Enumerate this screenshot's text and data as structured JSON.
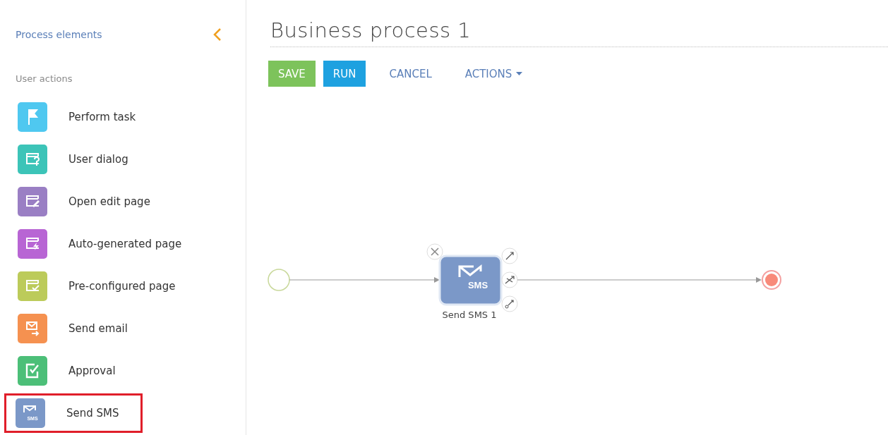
{
  "sidebar": {
    "title": "Process elements",
    "section": "User actions",
    "items": [
      {
        "label": "Perform task",
        "kind": "flag",
        "color": "#4fc8f0",
        "highlighted": false
      },
      {
        "label": "User dialog",
        "kind": "dialog",
        "color": "#3cc4b8",
        "highlighted": false
      },
      {
        "label": "Open edit page",
        "kind": "edit",
        "color": "#9a7fc4",
        "highlighted": false
      },
      {
        "label": "Auto-generated page",
        "kind": "bolt",
        "color": "#b865d4",
        "highlighted": false
      },
      {
        "label": "Pre-configured page",
        "kind": "check",
        "color": "#bccb5a",
        "highlighted": false
      },
      {
        "label": "Send email",
        "kind": "email",
        "color": "#f59150",
        "highlighted": false
      },
      {
        "label": "Approval",
        "kind": "approval",
        "color": "#4cbf78",
        "highlighted": false
      },
      {
        "label": "Send SMS",
        "kind": "sms",
        "color": "#7b98c8",
        "icon_text": "SMS",
        "highlighted": true
      }
    ]
  },
  "title": "Business process 1",
  "toolbar": [
    {
      "label": "SAVE",
      "kind": "save"
    },
    {
      "label": "RUN",
      "kind": "run"
    },
    {
      "label": "CANCEL",
      "kind": "link"
    },
    {
      "label": "ACTIONS",
      "kind": "menu"
    }
  ],
  "diagram": {
    "node": {
      "label": "Send SMS 1",
      "icon_text": "SMS",
      "selected": true
    }
  }
}
